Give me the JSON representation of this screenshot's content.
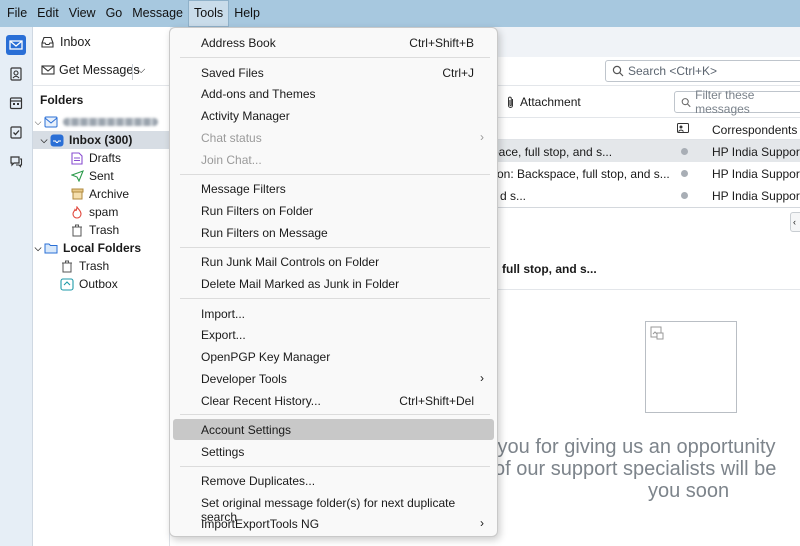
{
  "menubar": {
    "items": [
      {
        "label": "File"
      },
      {
        "label": "Edit"
      },
      {
        "label": "View"
      },
      {
        "label": "Go"
      },
      {
        "label": "Message"
      },
      {
        "label": "Tools"
      },
      {
        "label": "Help"
      }
    ]
  },
  "tab": {
    "label": "Inbox"
  },
  "toolbar": {
    "get_messages": "Get Messages",
    "search_placeholder": "Search <Ctrl+K>"
  },
  "folders": {
    "header": "Folders",
    "inbox": "Inbox (300)",
    "drafts": "Drafts",
    "sent": "Sent",
    "archive": "Archive",
    "spam": "spam",
    "trash": "Trash",
    "local_folders": "Local Folders",
    "local_trash": "Trash",
    "outbox": "Outbox"
  },
  "quickfilter": {
    "attachment": "Attachment",
    "filter_placeholder": "Filter these messages"
  },
  "thread_pane": {
    "correspondents_header": "Correspondents",
    "rows": [
      {
        "subject": "pace, full stop, and s...",
        "correspondent": "HP India Support"
      },
      {
        "subject": "on: Backspace, full stop, and s...",
        "correspondent": "HP India Support"
      },
      {
        "subject": "d s...",
        "correspondent": "HP India Support"
      }
    ]
  },
  "preview": {
    "subject": "ce, full stop, and s...",
    "line1": "k you for giving us an opportunity",
    "line2": "of our support specialists will be",
    "line3": "you soon"
  },
  "tools_menu": {
    "address_book": "Address Book",
    "address_book_sc": "Ctrl+Shift+B",
    "saved_files": "Saved Files",
    "saved_files_sc": "Ctrl+J",
    "addons": "Add-ons and Themes",
    "activity": "Activity Manager",
    "chat_status": "Chat status",
    "join_chat": "Join Chat...",
    "message_filters": "Message Filters",
    "run_filters_folder": "Run Filters on Folder",
    "run_filters_message": "Run Filters on Message",
    "run_junk": "Run Junk Mail Controls on Folder",
    "delete_junk": "Delete Mail Marked as Junk in Folder",
    "import": "Import...",
    "export": "Export...",
    "openpgp": "OpenPGP Key Manager",
    "developer": "Developer Tools",
    "clear_history": "Clear Recent History...",
    "clear_history_sc": "Ctrl+Shift+Del",
    "account_settings": "Account Settings",
    "settings": "Settings",
    "remove_dupes": "Remove Duplicates...",
    "set_original": "Set original message folder(s) for next duplicate search",
    "import_export_ng": "ImportExportTools NG"
  },
  "colors": {
    "menubar_bg": "#a7c8df",
    "accent": "#2a6fd6",
    "menu_hover": "#c8c8c8"
  }
}
